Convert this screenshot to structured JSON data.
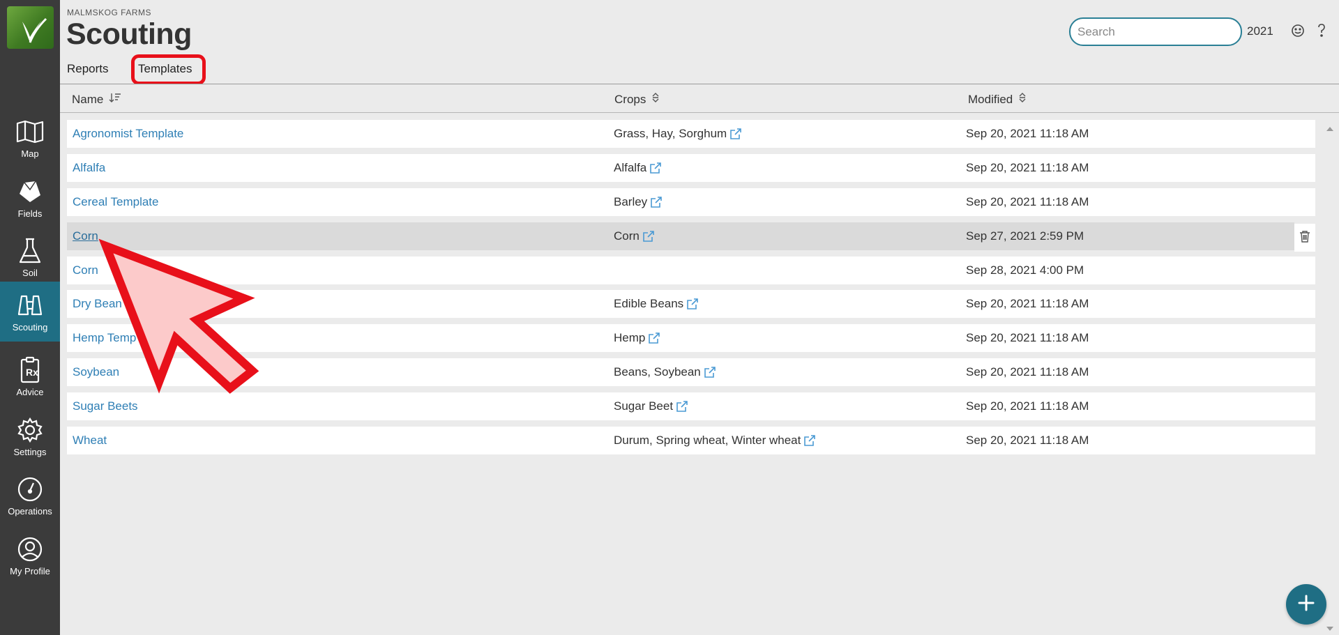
{
  "app": {
    "farm_name": "MALMSKOG FARMS",
    "page_title": "Scouting"
  },
  "sidebar": {
    "items": [
      {
        "label": "Map",
        "icon": "map-icon"
      },
      {
        "label": "Fields",
        "icon": "field-icon"
      },
      {
        "label": "Soil",
        "icon": "flask-icon"
      },
      {
        "label": "Scouting",
        "icon": "binoculars-icon",
        "active": true
      },
      {
        "label": "Advice",
        "icon": "prescription-clipboard-icon"
      },
      {
        "label": "Settings",
        "icon": "gear-icon"
      },
      {
        "label": "Operations",
        "icon": "gauge-icon"
      },
      {
        "label": "My Profile",
        "icon": "user-icon"
      }
    ]
  },
  "header": {
    "search_placeholder": "Search",
    "year": "2021"
  },
  "tabs": [
    {
      "label": "Reports"
    },
    {
      "label": "Templates",
      "active": true
    }
  ],
  "table": {
    "columns": {
      "name": "Name",
      "crops": "Crops",
      "modified": "Modified"
    },
    "rows": [
      {
        "name": "Agronomist Template",
        "crops": "Grass, Hay, Sorghum",
        "modified": "Sep 20, 2021 11:18 AM"
      },
      {
        "name": "Alfalfa",
        "crops": "Alfalfa",
        "modified": "Sep 20, 2021 11:18 AM"
      },
      {
        "name": "Cereal Template",
        "crops": "Barley",
        "modified": "Sep 20, 2021 11:18 AM"
      },
      {
        "name": "Corn",
        "crops": "Corn",
        "modified": "Sep 27, 2021 2:59 PM",
        "hovered": true
      },
      {
        "name": "Corn",
        "crops": "",
        "modified": "Sep 28, 2021 4:00 PM"
      },
      {
        "name": "Dry Bean",
        "crops": "Edible Beans",
        "modified": "Sep 20, 2021 11:18 AM"
      },
      {
        "name": "Hemp Temp",
        "crops": "Hemp",
        "modified": "Sep 20, 2021 11:18 AM"
      },
      {
        "name": "Soybean",
        "crops": "Beans, Soybean",
        "modified": "Sep 20, 2021 11:18 AM"
      },
      {
        "name": "Sugar Beets",
        "crops": "Sugar Beet",
        "modified": "Sep 20, 2021 11:18 AM"
      },
      {
        "name": "Wheat",
        "crops": "Durum, Spring wheat, Winter wheat",
        "modified": "Sep 20, 2021 11:18 AM"
      }
    ]
  },
  "colors": {
    "accent": "#1f6e84",
    "link": "#2f7fb5",
    "sidebar_bg": "#3b3b3b",
    "highlight_annotation": "#e8101a"
  }
}
